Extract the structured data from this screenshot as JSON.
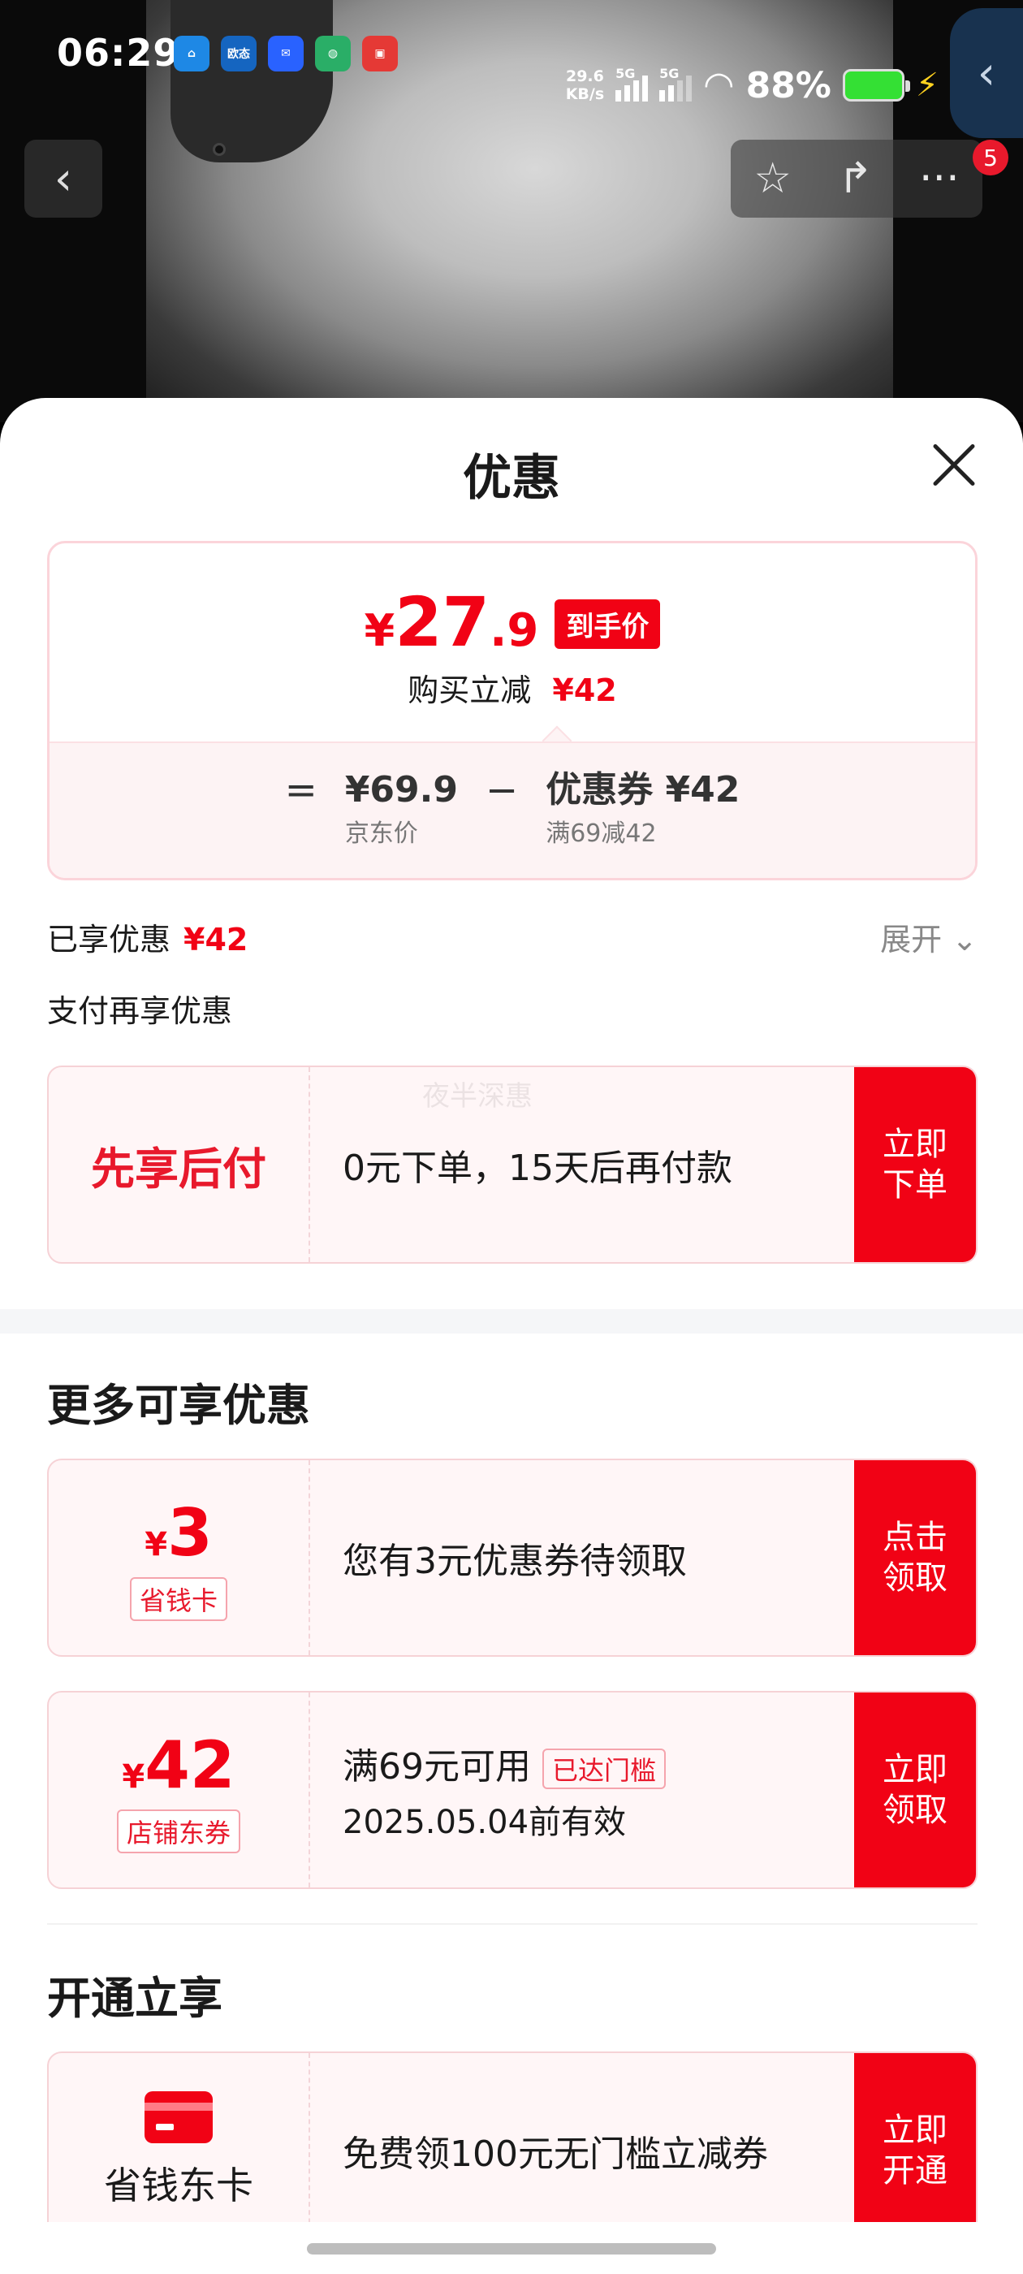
{
  "status_bar": {
    "time": "06:29",
    "apps": [
      {
        "icon": "home-app-icon",
        "label": "",
        "color": "#1e88e5"
      },
      {
        "icon": "ouzhi-app-icon",
        "label": "欧态",
        "color": "#1565c0"
      },
      {
        "icon": "mail-app-icon",
        "label": "✉",
        "color": "#2962ff"
      },
      {
        "icon": "wechat-app-icon",
        "label": "",
        "color": "#2aae67"
      },
      {
        "icon": "shop-app-icon",
        "label": "",
        "color": "#e53935"
      }
    ],
    "net_speed_value": "29.6",
    "net_speed_unit": "KB/s",
    "signal1_label": "5G",
    "signal2_label": "5G",
    "battery_percent": "88%"
  },
  "nav": {
    "back_glyph": "‹",
    "star_glyph": "☆",
    "share_glyph": "↱",
    "more_glyph": "···",
    "badge_count": "5"
  },
  "sheet": {
    "title": "优惠",
    "price": {
      "currency": "¥",
      "integer": "27",
      "decimal": ".9",
      "tag": "到手价",
      "reduce_label": "购买立减",
      "reduce_amount": "¥42",
      "eq": "=",
      "minus": "−",
      "jd_price": "¥69.9",
      "jd_price_label": "京东价",
      "coupon_value": "优惠券 ¥42",
      "coupon_condition": "满69减42"
    },
    "enjoyed_label": "已享优惠",
    "enjoyed_amount": "¥42",
    "expand_label": "展开 ⌄",
    "pay_more_label": "支付再享优惠",
    "pay_later": {
      "title": "先享后付",
      "desc": "0元下单，15天后再付款",
      "cta": "立即下单",
      "watermark": "夜半深惠"
    },
    "more_title": "更多可享优惠",
    "coupon_save_card": {
      "currency": "¥",
      "value": "3",
      "tag": "省钱卡",
      "desc": "您有3元优惠券待领取",
      "cta": "点击领取"
    },
    "coupon_store": {
      "currency": "¥",
      "value": "42",
      "tag": "店铺东券",
      "desc": "满69元可用",
      "threshold_tag": "已达门槛",
      "expiry": "2025.05.04前有效",
      "cta": "立即领取"
    },
    "open_title": "开通立享",
    "open_card": {
      "name": "省钱东卡",
      "desc": "免费领100元无门槛立减券",
      "cta": "立即开通"
    }
  }
}
